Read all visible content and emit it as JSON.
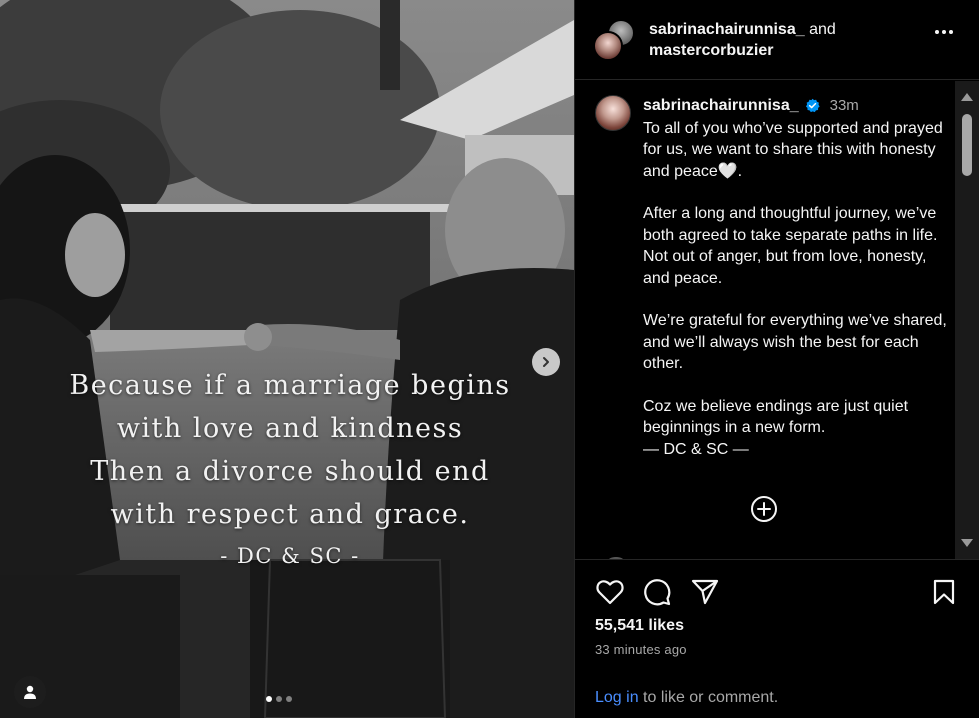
{
  "post": {
    "overlay_lines": [
      "Because if a marriage begins",
      "with love and kindness",
      "Then a divorce should end",
      "with respect and grace."
    ],
    "overlay_signature": "- DC & SC -",
    "carousel": {
      "count": 3,
      "active_index": 0
    }
  },
  "header": {
    "user1": "sabrinachairunnisa_",
    "connector": "and",
    "user2": "mastercorbuzier"
  },
  "caption": {
    "username": "sabrinachairunnisa_",
    "time": "33m",
    "paragraphs": [
      "To all of you who’ve supported and prayed for us, we want to share this with honesty and peace🤍.",
      "After a long and thoughtful journey, we’ve both agreed to take separate paths in life. Not out of anger, but from love, honesty, and peace.",
      "We’re grateful for everything we’ve shared, and we’ll always wish the best for each other.",
      "Coz we believe endings are just quiet beginnings in a new form.\n— DC & SC —"
    ]
  },
  "actions": {
    "likes": "55,541 likes",
    "time_ago": "33 minutes ago",
    "login_link": "Log in",
    "login_rest": " to like or comment."
  },
  "icons": {
    "like": "heart-icon",
    "comment": "comment-icon",
    "share": "send-icon",
    "save": "bookmark-icon",
    "add": "plus-circle-icon",
    "verified": "verified-badge-icon",
    "next": "chevron-right-icon",
    "tag": "user-tag-icon",
    "more": "more-options-icon"
  },
  "colors": {
    "link": "#4a8eff",
    "verified": "#0095f6",
    "muted": "#a8a8a8"
  }
}
